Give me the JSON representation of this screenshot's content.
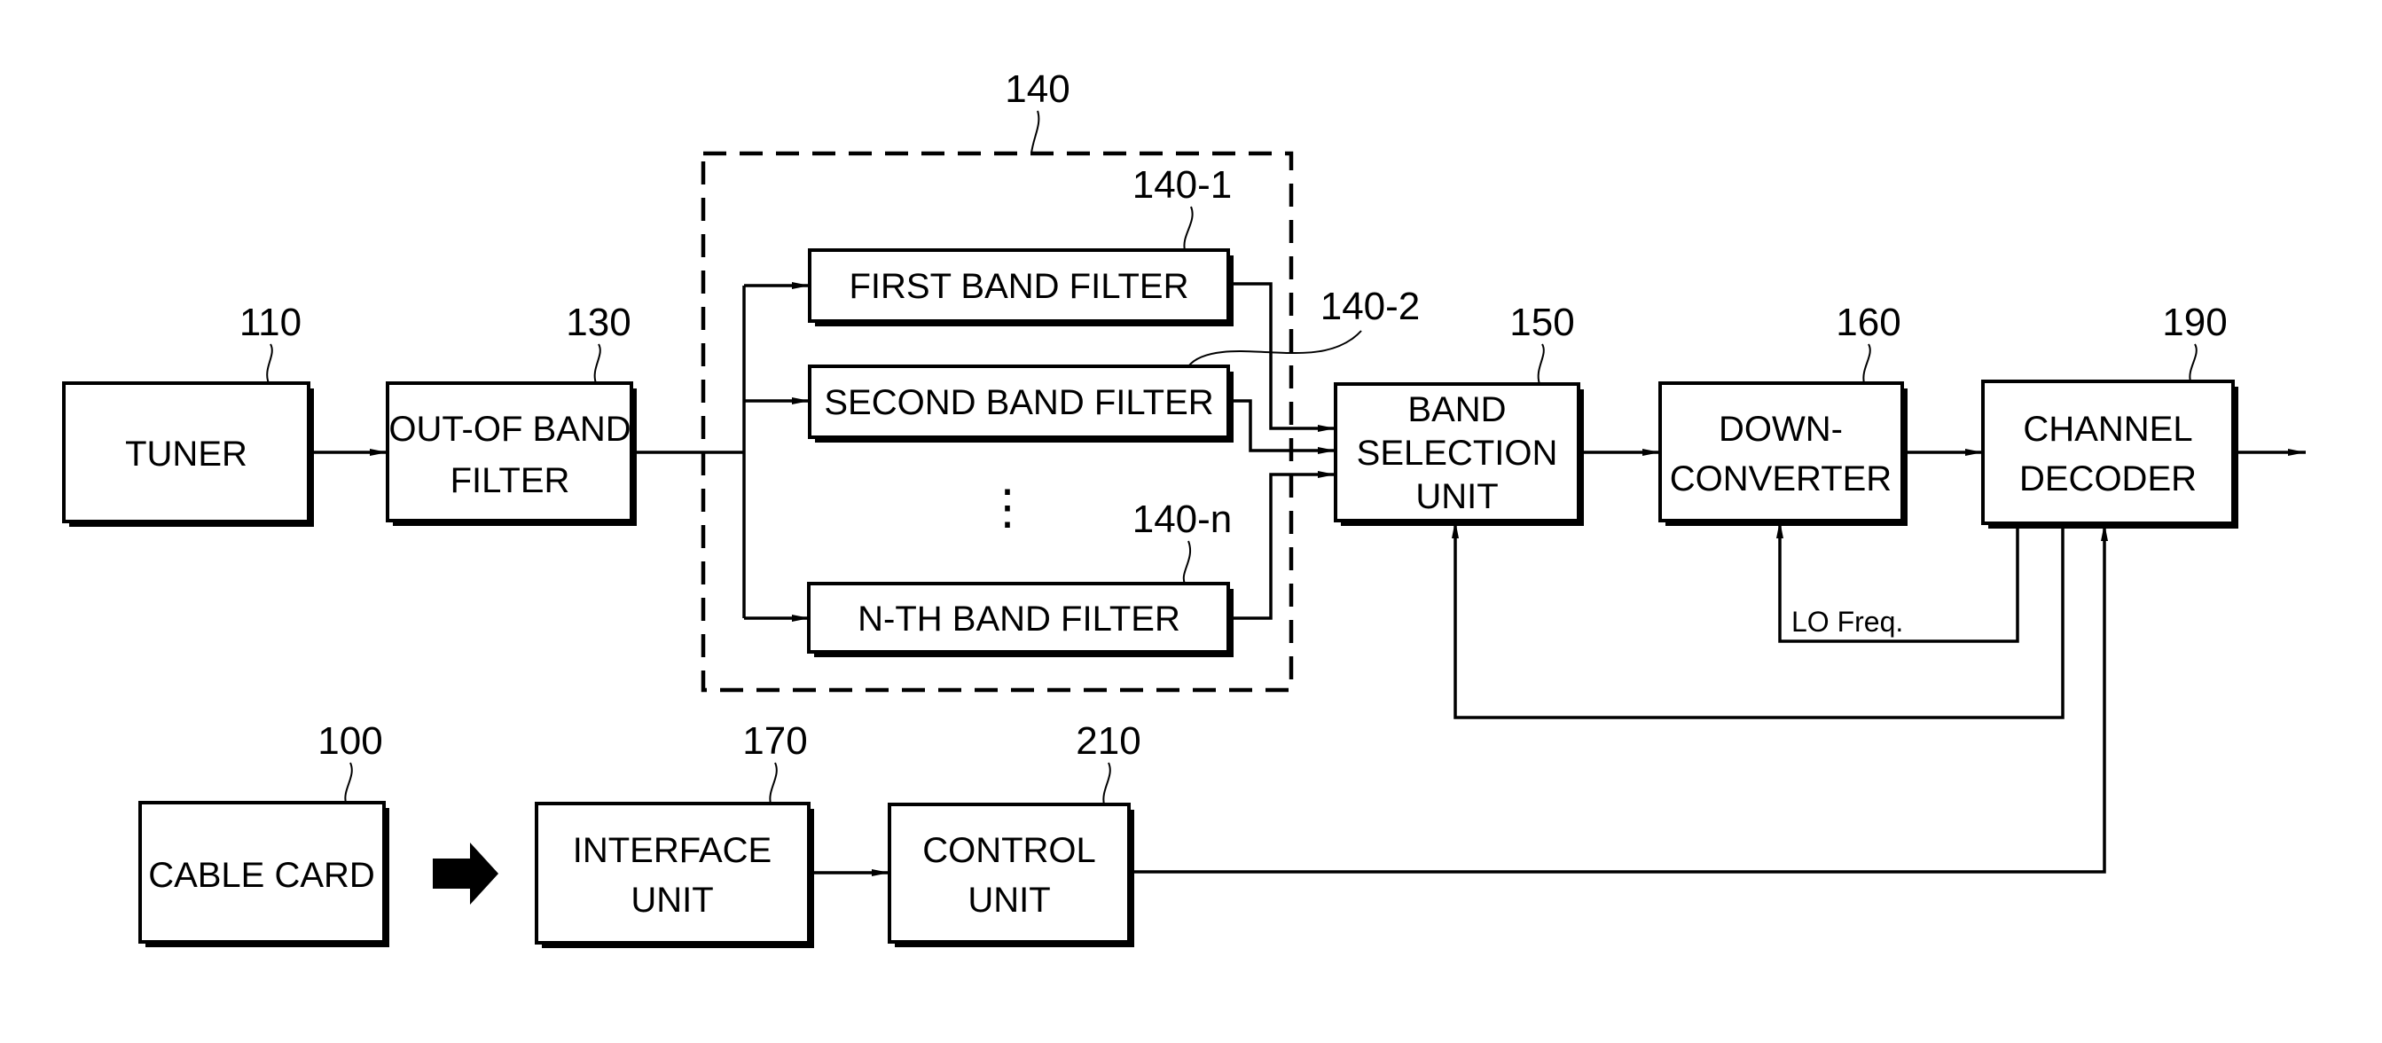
{
  "diagram": {
    "type": "block-diagram",
    "blocks": {
      "tuner": {
        "ref": "110",
        "lines": [
          "TUNER"
        ]
      },
      "oob_filter": {
        "ref": "130",
        "lines": [
          "OUT-OF BAND",
          "FILTER"
        ]
      },
      "filter_group": {
        "ref": "140"
      },
      "first_filter": {
        "ref": "140-1",
        "lines": [
          "FIRST BAND FILTER"
        ]
      },
      "second_filter": {
        "ref": "140-2",
        "lines": [
          "SECOND BAND FILTER"
        ]
      },
      "nth_filter": {
        "ref": "140-n",
        "lines": [
          "N-TH BAND FILTER"
        ]
      },
      "band_selection": {
        "ref": "150",
        "lines": [
          "BAND",
          "SELECTION",
          "UNIT"
        ]
      },
      "down_converter": {
        "ref": "160",
        "lines": [
          "DOWN-",
          "CONVERTER"
        ]
      },
      "channel_decoder": {
        "ref": "190",
        "lines": [
          "CHANNEL",
          "DECODER"
        ]
      },
      "cable_card": {
        "ref": "100",
        "lines": [
          "CABLE CARD"
        ]
      },
      "interface_unit": {
        "ref": "170",
        "lines": [
          "INTERFACE",
          "UNIT"
        ]
      },
      "control_unit": {
        "ref": "210",
        "lines": [
          "CONTROL",
          "UNIT"
        ]
      }
    },
    "signals": {
      "lo_freq": "LO Freq.",
      "ellipsis": "⋮"
    },
    "connections": [
      [
        "tuner",
        "oob_filter"
      ],
      [
        "oob_filter",
        "first_filter"
      ],
      [
        "oob_filter",
        "second_filter"
      ],
      [
        "oob_filter",
        "nth_filter"
      ],
      [
        "first_filter",
        "band_selection"
      ],
      [
        "second_filter",
        "band_selection"
      ],
      [
        "nth_filter",
        "band_selection"
      ],
      [
        "band_selection",
        "down_converter"
      ],
      [
        "down_converter",
        "channel_decoder"
      ],
      [
        "channel_decoder",
        "down_converter",
        "LO Freq."
      ],
      [
        "channel_decoder",
        "band_selection"
      ],
      [
        "cable_card",
        "interface_unit"
      ],
      [
        "interface_unit",
        "control_unit"
      ],
      [
        "control_unit",
        "channel_decoder"
      ]
    ]
  }
}
